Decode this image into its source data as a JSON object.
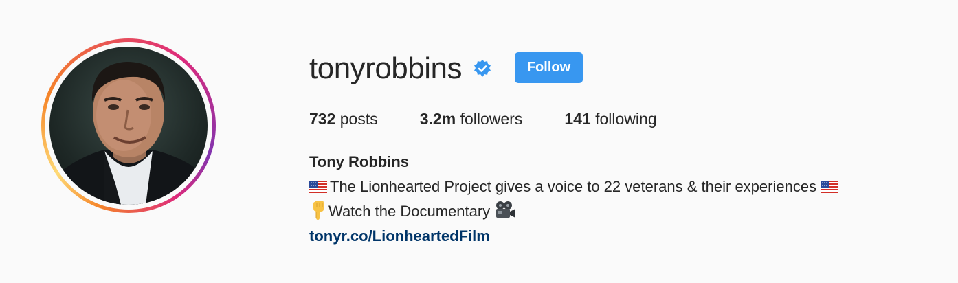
{
  "profile": {
    "username": "tonyrobbins",
    "verified": true,
    "follow_label": "Follow",
    "full_name": "Tony Robbins",
    "stats": {
      "posts_count": "732",
      "posts_label": " posts",
      "followers_count": "3.2m",
      "followers_label": " followers",
      "following_count": "141",
      "following_label": " following"
    },
    "bio": {
      "line1": "The Lionhearted Project gives a voice to 22 veterans & their experiences",
      "line2": "Watch the Documentary",
      "link": "tonyr.co/LionheartedFilm"
    }
  },
  "icons": {
    "verified": "verified-badge-icon",
    "flag": "us-flag-emoji",
    "hand": "pointing-down-emoji",
    "camera": "movie-camera-emoji"
  },
  "colors": {
    "follow_button": "#3897f0",
    "link": "#003569",
    "text": "#262626",
    "background": "#fafafa"
  }
}
